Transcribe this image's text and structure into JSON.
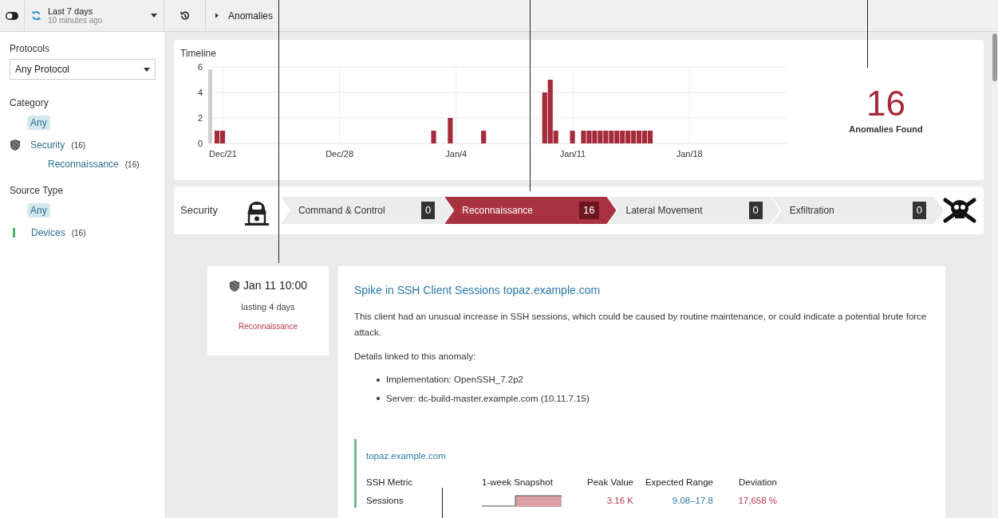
{
  "topbar": {
    "time_range": "Last 7 days",
    "updated": "10 minutes ago",
    "breadcrumb": "Anomalies"
  },
  "sidebar": {
    "sections": [
      {
        "title": "Protocols",
        "kind": "select",
        "value": "Any Protocol"
      },
      {
        "title": "Category",
        "kind": "tree",
        "items": [
          {
            "kind": "plain",
            "label": "Any",
            "selected": true
          },
          {
            "kind": "shield",
            "label": "Security",
            "count": "(16)",
            "selected": false,
            "children": [
              {
                "kind": "plain",
                "label": "Reconnaissance",
                "count": "(16)",
                "selected": false
              }
            ]
          }
        ]
      },
      {
        "title": "Source Type",
        "kind": "tree",
        "items": [
          {
            "kind": "plain",
            "label": "Any",
            "selected": true
          },
          {
            "kind": "bar",
            "label": "Devices",
            "count": "(16)",
            "selected": false
          }
        ]
      }
    ]
  },
  "timeline": {
    "title": "Timeline",
    "chart_data": {
      "type": "bar",
      "categories": [
        null,
        null,
        "Dec/21",
        null,
        null,
        null,
        null,
        null,
        null,
        null,
        null,
        null,
        null,
        null,
        null,
        null,
        null,
        null,
        null,
        null,
        null,
        null,
        null,
        "Dec/28",
        null,
        null,
        null,
        null,
        null,
        null,
        null,
        null,
        null,
        null,
        null,
        null,
        null,
        null,
        null,
        null,
        null,
        null,
        null,
        null,
        "Jan/4",
        null,
        null,
        null,
        null,
        null,
        null,
        null,
        null,
        null,
        null,
        null,
        null,
        null,
        null,
        null,
        null,
        null,
        null,
        null,
        null,
        "Jan/11",
        null,
        null,
        null,
        null,
        null,
        null,
        null,
        null,
        null,
        null,
        null,
        null,
        null,
        null,
        null,
        null,
        null,
        null,
        null,
        null,
        "Jan/18",
        null,
        null,
        null,
        null,
        null,
        null,
        null,
        null,
        null,
        null,
        null,
        null,
        null,
        null,
        null,
        null,
        null
      ],
      "series": [
        {
          "color": "#a52a3a",
          "values": [
            null,
            1,
            1,
            null,
            null,
            null,
            null,
            null,
            null,
            null,
            null,
            null,
            null,
            null,
            null,
            null,
            null,
            null,
            null,
            null,
            null,
            null,
            null,
            null,
            null,
            null,
            null,
            null,
            null,
            null,
            null,
            null,
            null,
            null,
            null,
            null,
            null,
            null,
            null,
            null,
            1,
            null,
            null,
            2,
            null,
            null,
            null,
            null,
            null,
            1,
            null,
            null,
            null,
            null,
            null,
            null,
            null,
            null,
            null,
            null,
            4,
            5,
            1,
            null,
            null,
            1,
            null,
            1,
            1,
            1,
            1,
            1,
            1,
            1,
            1,
            1,
            1,
            1,
            1,
            1,
            null,
            null,
            null,
            null,
            null,
            null,
            null,
            null,
            null,
            null,
            null,
            null,
            null,
            null,
            null,
            null,
            null,
            null,
            null,
            null,
            null,
            null,
            null,
            null
          ]
        }
      ],
      "ylim": [
        0,
        6
      ],
      "yticks": [
        0,
        2,
        4,
        6
      ],
      "grid": true
    },
    "count": "16",
    "count_label": "Anomalies Found"
  },
  "stages": {
    "title": "Security",
    "items": [
      {
        "label": "Command & Control",
        "count": "0",
        "selected": false
      },
      {
        "label": "Reconnaissance",
        "count": "16",
        "selected": true
      },
      {
        "label": "Lateral Movement",
        "count": "0",
        "selected": false
      },
      {
        "label": "Exfiltration",
        "count": "0",
        "selected": false
      }
    ]
  },
  "anomaly": {
    "time": "Jan 11 10:00",
    "duration": "lasting 4 days",
    "category": "Reconnaissance",
    "title": "Spike in SSH Client Sessions topaz.example.com",
    "description": "This client had an unusual increase in SSH sessions, which could be caused by routine maintenance, or could indicate a potential brute force attack.",
    "details_heading": "Details linked to this anomaly:",
    "details": [
      "Implementation: OpenSSH_7.2p2",
      "Server: dc-build-master.example.com (10.11.7.15)"
    ],
    "metric": {
      "host": "topaz.example.com",
      "columns": [
        "SSH Metric",
        "1-week Snapshot",
        "Peak Value",
        "Expected Range",
        "Deviation"
      ],
      "row": {
        "name": "Sessions",
        "peak": "3.16 K",
        "range": "9.08–17.8",
        "deviation": "17,658 %"
      }
    }
  }
}
